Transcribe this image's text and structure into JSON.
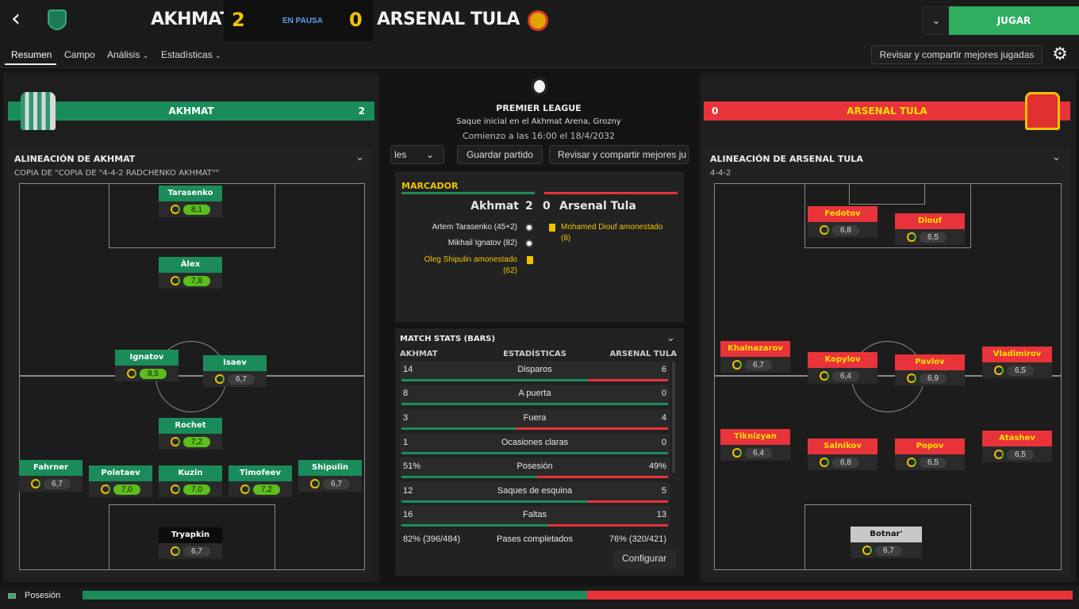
{
  "header": {
    "home_team": "AKHMAT",
    "home_score": "2",
    "status": "EN PAUSA",
    "away_score": "0",
    "away_team": "ARSENAL TULA",
    "play_label": "JUGAR"
  },
  "nav": {
    "tabs": [
      "Resumen",
      "Campo",
      "Análisis",
      "Estadísticas"
    ],
    "share_label": "Revisar y compartir mejores jugadas"
  },
  "match": {
    "competition": "PREMIER LEAGUE",
    "venue": "Saque inicial en el Akhmat Arena, Grozny",
    "kickoff": "Comienzo a las 16:00 el 18/4/2032",
    "btn_partial": "les",
    "save_label": "Guardar partido",
    "share_partial": "Revisar y compartir mejores ju"
  },
  "home_bar": {
    "name": "AKHMAT",
    "score": "2",
    "color": "#1a8c5a"
  },
  "away_bar": {
    "name": "ARSENAL TULA",
    "score": "0",
    "color": "#e8333a"
  },
  "home_lineup": {
    "title": "ALINEACIÓN DE AKHMAT",
    "formation": "COPIA DE \"COPIA DE \"4-4-2 RADCHENKO AKHMAT\"\"",
    "players": [
      {
        "name": "Tarasenko",
        "rating": "8,1",
        "high": true
      },
      {
        "name": "Àlex",
        "rating": "7,8",
        "high": true
      },
      {
        "name": "Ignatov",
        "rating": "8,5",
        "high": true
      },
      {
        "name": "Isaev",
        "rating": "6,7",
        "high": false
      },
      {
        "name": "Rochet",
        "rating": "7,2",
        "high": true
      },
      {
        "name": "Fahrner",
        "rating": "6,7",
        "high": false
      },
      {
        "name": "Poletaev",
        "rating": "7,0",
        "high": true
      },
      {
        "name": "Kuzin",
        "rating": "7,0",
        "high": true
      },
      {
        "name": "Timofeev",
        "rating": "7,2",
        "high": true
      },
      {
        "name": "Shipulin",
        "rating": "6,7",
        "high": false
      },
      {
        "name": "Tryapkin",
        "rating": "6,7",
        "high": false
      }
    ]
  },
  "away_lineup": {
    "title": "ALINEACIÓN DE ARSENAL TULA",
    "formation": "4-4-2",
    "players": [
      {
        "name": "Fedotov",
        "rating": "6,8",
        "high": false
      },
      {
        "name": "Diouf",
        "rating": "6,5",
        "high": false
      },
      {
        "name": "Khalnazarov",
        "rating": "6,7",
        "high": false
      },
      {
        "name": "Kopylov",
        "rating": "6,4",
        "high": false
      },
      {
        "name": "Pavlov",
        "rating": "6,9",
        "high": false
      },
      {
        "name": "Vladimirov",
        "rating": "6,5",
        "high": false
      },
      {
        "name": "Tiknizyan",
        "rating": "6,4",
        "high": false
      },
      {
        "name": "Salnikov",
        "rating": "6,8",
        "high": false
      },
      {
        "name": "Popov",
        "rating": "6,5",
        "high": false
      },
      {
        "name": "Atashev",
        "rating": "6,5",
        "high": false
      },
      {
        "name": "Botnar'",
        "rating": "6,7",
        "high": false
      }
    ]
  },
  "scoreboard": {
    "title": "MARCADOR",
    "home": "Akhmat",
    "home_score": "2",
    "away_score": "0",
    "away": "Arsenal Tula",
    "home_events": [
      {
        "text": "Artem Tarasenko (45+2)",
        "type": "goal"
      },
      {
        "text": "Mikhail Ignatov (82)",
        "type": "goal"
      },
      {
        "text": "Oleg Shipulin amonestado",
        "minute": "(62)",
        "type": "yellow"
      }
    ],
    "away_events": [
      {
        "text": "Mohamed Diouf amonestado",
        "minute": "(8)",
        "type": "yellow"
      }
    ]
  },
  "match_stats": {
    "title": "MATCH STATS (BARS)",
    "home_label": "AKHMAT",
    "center_label": "ESTADÍSTICAS",
    "away_label": "ARSENAL TULA",
    "rows": [
      {
        "home": "14",
        "label": "Disparos",
        "away": "6",
        "home_frac": 0.7
      },
      {
        "home": "8",
        "label": "A puerta",
        "away": "0",
        "home_frac": 1.0
      },
      {
        "home": "3",
        "label": "Fuera",
        "away": "4",
        "home_frac": 0.43
      },
      {
        "home": "1",
        "label": "Ocasiones claras",
        "away": "0",
        "home_frac": 1.0
      },
      {
        "home": "51%",
        "label": "Posesión",
        "away": "49%",
        "home_frac": 0.51
      },
      {
        "home": "12",
        "label": "Saques de esquina",
        "away": "5",
        "home_frac": 0.7
      },
      {
        "home": "16",
        "label": "Faltas",
        "away": "13",
        "home_frac": 0.55
      },
      {
        "home": "82% (396/484)",
        "label": "Pases completados",
        "away": "76% (320/421)",
        "home_frac": 0.5
      }
    ],
    "configure_label": "Configurar"
  },
  "footer": {
    "label": "Posesión",
    "home_share": 0.51
  }
}
